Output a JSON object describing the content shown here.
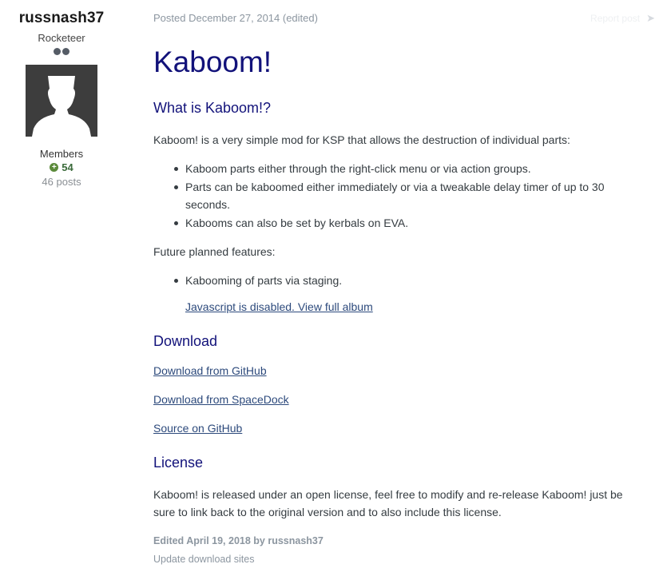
{
  "author": {
    "name": "russnash37",
    "rank": "Rocketeer",
    "group": "Members",
    "reputation": "54",
    "posts": "46 posts"
  },
  "post": {
    "meta": "Posted December 27, 2014 (edited)",
    "report_label": "Report post",
    "title": "Kaboom!",
    "section1_heading": "What is Kaboom!?",
    "intro": "Kaboom! is a very simple mod for KSP that allows the destruction of individual parts:",
    "features": [
      "Kaboom parts either through the right-click menu or via action groups.",
      "Parts can be kaboomed either immediately or via a tweakable delay timer of up to 30 seconds.",
      "Kabooms can also be set by kerbals on EVA."
    ],
    "future_label": "Future planned features:",
    "future": [
      "Kabooming of parts via staging."
    ],
    "album_link": "Javascript is disabled. View full album",
    "download_heading": "Download",
    "links": {
      "github": "Download from GitHub",
      "spacedock": "Download from SpaceDock",
      "source": "Source on GitHub"
    },
    "license_heading": "License",
    "license_text": "Kaboom! is released under an open license, feel free to modify and re-release Kaboom! just be sure to link back to the original version and to also include this license.",
    "edited": "Edited April 19, 2018 by russnash37",
    "edit_reason": "Update download sites"
  }
}
